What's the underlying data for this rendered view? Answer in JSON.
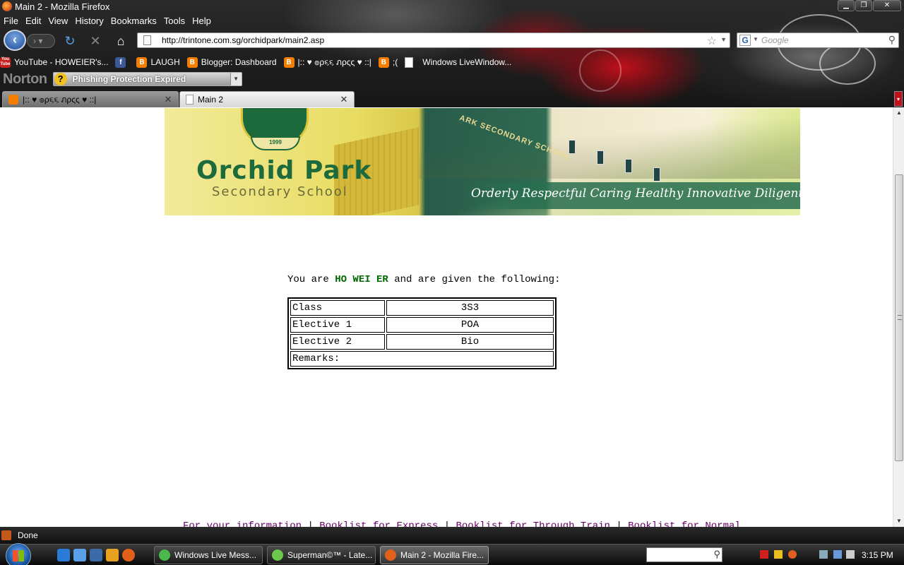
{
  "window": {
    "title": "Main 2 - Mozilla Firefox"
  },
  "menu": [
    "File",
    "Edit",
    "View",
    "History",
    "Bookmarks",
    "Tools",
    "Help"
  ],
  "navigation": {
    "url": "http://trintone.com.sg/orchidpark/main2.asp",
    "search_placeholder": "Google"
  },
  "bookmarks": [
    {
      "label": "YouTube - HOWEIER's...",
      "icon": "youtube-icon"
    },
    {
      "label": "",
      "icon": "facebook-icon"
    },
    {
      "label": "LAUGH",
      "icon": "blogger-icon"
    },
    {
      "label": "Blogger: Dashboard",
      "icon": "blogger-icon"
    },
    {
      "label": "|:: ♥ ๏ρ૬૬ ภρςς ♥ ::|",
      "icon": "blogger-icon"
    },
    {
      "label": ";(",
      "icon": "blogger-icon"
    },
    {
      "label": "Windows LiveWindow...",
      "icon": "page-icon"
    }
  ],
  "norton": {
    "brand": "Norton",
    "phishing_status": "Phishing Protection Expired"
  },
  "tabs": [
    {
      "label": "|:: ♥ ๏ρ૬૬ ภρςς ♥ ::|",
      "active": false
    },
    {
      "label": "Main 2",
      "active": true
    }
  ],
  "banner": {
    "school_name": "Orchid Park",
    "school_sub": "Secondary School",
    "motto": "Orderly Respectful Caring Healthy Innovative Diligent",
    "crest_year": "1999",
    "wall_sign": "ARK SECONDARY SCHOOL"
  },
  "page": {
    "intro_prefix": "You are",
    "student_name": "HO WEI ER",
    "intro_suffix": "and are given the following:",
    "rows": [
      {
        "label": "Class",
        "value": "3S3"
      },
      {
        "label": "Elective 1",
        "value": "POA"
      },
      {
        "label": "Elective 2",
        "value": "Bio"
      }
    ],
    "remarks_label": "Remarks:",
    "footer_links": [
      "For your information",
      "Booklist for Express",
      "Booklist for Through Train",
      "Booklist for Normal"
    ]
  },
  "status": {
    "text": "Done"
  },
  "taskbar": {
    "buttons": [
      {
        "label": "Windows Live Mess...",
        "active": false
      },
      {
        "label": "Superman©™ - Late...",
        "active": false
      },
      {
        "label": "Main 2 - Mozilla Fire...",
        "active": true
      }
    ],
    "clock": "3:15 PM"
  },
  "colors": {
    "student_name": "#006600",
    "link": "#660066",
    "banner_green": "#1d6b3d"
  }
}
